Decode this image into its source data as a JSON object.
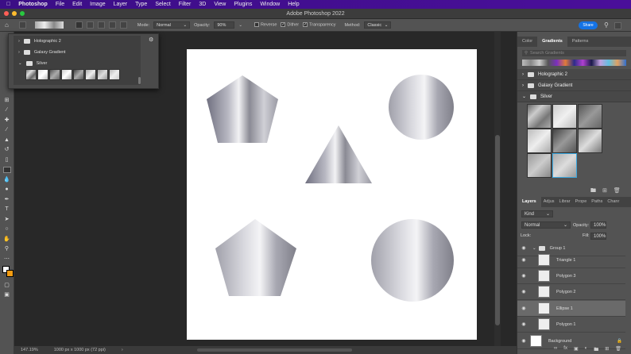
{
  "menubar": {
    "apple": "",
    "app": "Photoshop",
    "items": [
      "File",
      "Edit",
      "Image",
      "Layer",
      "Type",
      "Select",
      "Filter",
      "3D",
      "View",
      "Plugins",
      "Window",
      "Help"
    ]
  },
  "title": "Adobe Photoshop 2022",
  "options": {
    "mode_label": "Mode:",
    "mode": "Normal",
    "opacity_label": "Opacity:",
    "opacity": "90%",
    "reverse": "Reverse",
    "dither": "Dither",
    "transparency": "Transparency",
    "method_label": "Method:",
    "method": "Classic",
    "share": "Share"
  },
  "popup": {
    "folders": [
      "Holographic 2",
      "Galaxy Gradient",
      "Silver"
    ]
  },
  "gradients_panel": {
    "tabs": [
      "Color",
      "Gradients",
      "Patterns"
    ],
    "search_placeholder": "Search Gradients",
    "folders": [
      "Holographic 2",
      "Galaxy Gradient",
      "Silver"
    ]
  },
  "layers_panel": {
    "tabs": [
      "Layers",
      "Adjus",
      "Librar",
      "Prope",
      "Paths",
      "Chanr"
    ],
    "filter": "Kind",
    "blend": "Normal",
    "opacity_label": "Opacity:",
    "opacity": "100%",
    "lock_label": "Lock:",
    "fill_label": "Fill:",
    "fill": "100%",
    "layers": [
      "Group 1",
      "Triangle 1",
      "Polygon 3",
      "Polygon 2",
      "Ellipse 1",
      "Polygon 1",
      "Background"
    ]
  },
  "status": {
    "zoom": "147.19%",
    "doc_size": "1000 px x 1000 px (72 ppi)"
  }
}
